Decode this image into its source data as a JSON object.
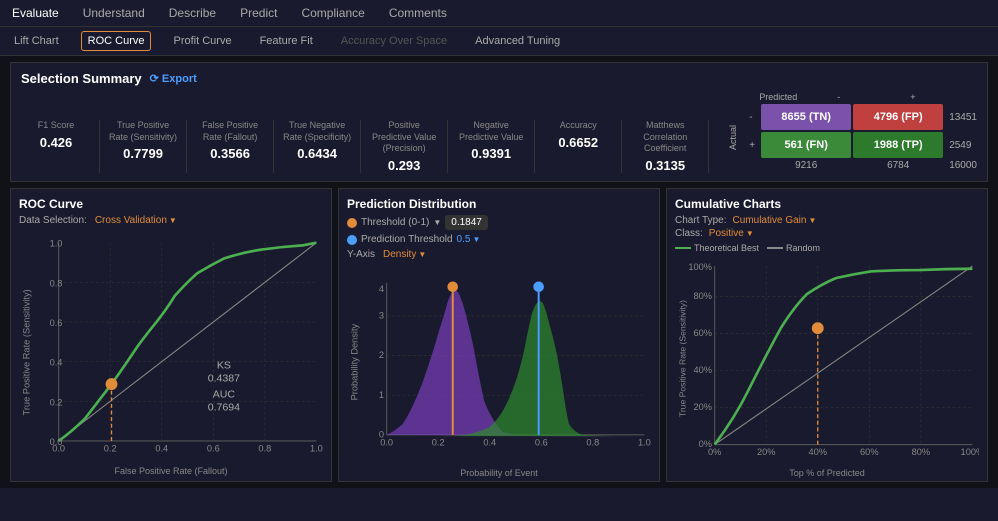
{
  "topNav": {
    "items": [
      "Evaluate",
      "Understand",
      "Describe",
      "Predict",
      "Compliance",
      "Comments"
    ],
    "active": "Evaluate"
  },
  "subNav": {
    "items": [
      "Lift Chart",
      "ROC Curve",
      "Profit Curve",
      "Feature Fit",
      "Accuracy Over Space",
      "Advanced Tuning"
    ],
    "active": "ROC Curve",
    "disabled": [
      "Accuracy Over Space"
    ]
  },
  "selectionSummary": {
    "title": "Selection Summary",
    "exportLabel": "⟳ Export",
    "metrics": [
      {
        "label": "F1 Score",
        "value": "0.426"
      },
      {
        "label": "True Positive Rate (Sensitivity)",
        "value": "0.7799"
      },
      {
        "label": "False Positive Rate (Fallout)",
        "value": "0.3566"
      },
      {
        "label": "True Negative Rate (Specificity)",
        "value": "0.6434"
      },
      {
        "label": "Positive Predictive Value (Precision)",
        "value": "0.293"
      },
      {
        "label": "Negative Predictive Value",
        "value": "0.9391"
      },
      {
        "label": "Accuracy",
        "value": "0.6652"
      },
      {
        "label": "Matthews Correlation Coefficient",
        "value": "0.3135"
      }
    ],
    "predicted": "Predicted",
    "actual": "Actual",
    "confusionMatrix": {
      "tn": "8655 (TN)",
      "fp": "4796 (FP)",
      "fn": "561 (FN)",
      "tp": "1988 (TP)",
      "colTotals": [
        "9216",
        "6784"
      ],
      "rowTotals": [
        "13451",
        "2549"
      ],
      "grandTotal": "16000"
    }
  },
  "rocChart": {
    "title": "ROC Curve",
    "dataSelectionLabel": "Data Selection:",
    "dataSelectionValue": "Cross Validation",
    "ksLabel": "KS",
    "ksValue": "0.4387",
    "aucLabel": "AUC",
    "aucValue": "0.7694",
    "xAxisLabel": "False Positive Rate (Fallout)",
    "yAxisLabel": "True Positive Rate (Sensitivity)"
  },
  "predictionDistribution": {
    "title": "Prediction Distribution",
    "thresholdLabel": "Threshold (0-1)",
    "thresholdValue": "0.1847",
    "predictionThresholdLabel": "Prediction Threshold",
    "predictionThresholdValue": "0.5",
    "yAxisLabel": "Y-Axis",
    "yAxisValue": "Density",
    "xAxisLabel": "Probability of Event",
    "yAxisChartLabel": "Probability Density"
  },
  "cumulativeCharts": {
    "title": "Cumulative Charts",
    "chartTypeLabel": "Chart Type:",
    "chartTypeValue": "Cumulative Gain",
    "classLabel": "Class:",
    "classValue": "Positive",
    "legendItems": [
      "Theoretical Best",
      "Random"
    ],
    "xAxisLabel": "Top % of Predicted",
    "yAxisLabel": "True Positive Rate (Sensitivity)"
  }
}
